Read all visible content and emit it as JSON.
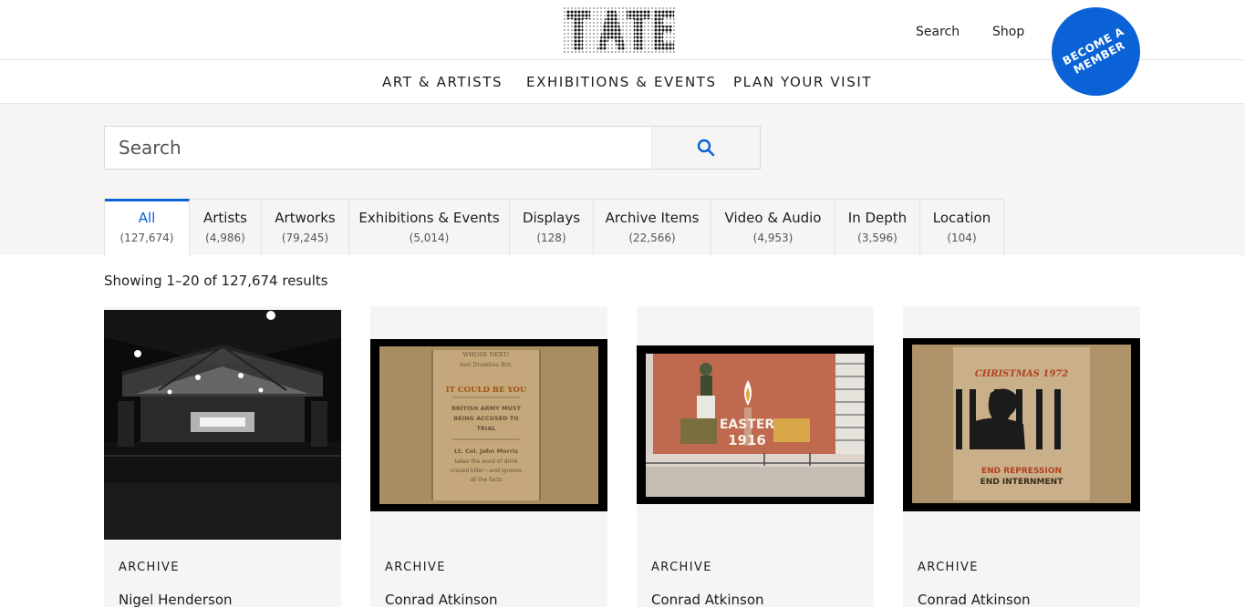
{
  "header": {
    "logo_name": "tate-logo",
    "search_link": "Search",
    "shop_link": "Shop",
    "member_button": "BECOME A MEMBER"
  },
  "nav": {
    "items": [
      "ART & ARTISTS",
      "EXHIBITIONS & EVENTS",
      "PLAN YOUR VISIT"
    ]
  },
  "search": {
    "placeholder": "Search",
    "button_icon": "search-icon"
  },
  "tabs": [
    {
      "label": "All",
      "count": "(127,674)",
      "active": true
    },
    {
      "label": "Artists",
      "count": "(4,986)"
    },
    {
      "label": "Artworks",
      "count": "(79,245)"
    },
    {
      "label": "Exhibitions & Events",
      "count": "(5,014)"
    },
    {
      "label": "Displays",
      "count": "(128)"
    },
    {
      "label": "Archive Items",
      "count": "(22,566)"
    },
    {
      "label": "Video & Audio",
      "count": "(4,953)"
    },
    {
      "label": "In Depth",
      "count": "(3,596)"
    },
    {
      "label": "Location",
      "count": "(104)"
    }
  ],
  "results": {
    "summary": "Showing 1–20 of 127,674 results",
    "cards": [
      {
        "type": "ARCHIVE",
        "title": "Nigel Henderson"
      },
      {
        "type": "ARCHIVE",
        "title": "Conrad Atkinson"
      },
      {
        "type": "ARCHIVE",
        "title": "Conrad Atkinson"
      },
      {
        "type": "ARCHIVE",
        "title": "Conrad Atkinson"
      }
    ],
    "image_texts": {
      "card2": [
        "WHOSE NEXT!",
        "Asst Drumbau Brit.",
        "IT COULD BE YOU",
        "BRITISH ARMY MUST",
        "BEING ACCUSED TO",
        "TRIAL",
        "Lt. Col. John Morris",
        "takes the word of drink",
        "crazed killer—and ignores",
        "all the facts"
      ],
      "card3": [
        "EASTER",
        "1916"
      ],
      "card4": [
        "CHRISTMAS 1972",
        "END REPRESSION",
        "END INTERNMENT"
      ]
    }
  },
  "colors": {
    "accent": "#0a62d6",
    "panel": "#f6f5f3"
  }
}
